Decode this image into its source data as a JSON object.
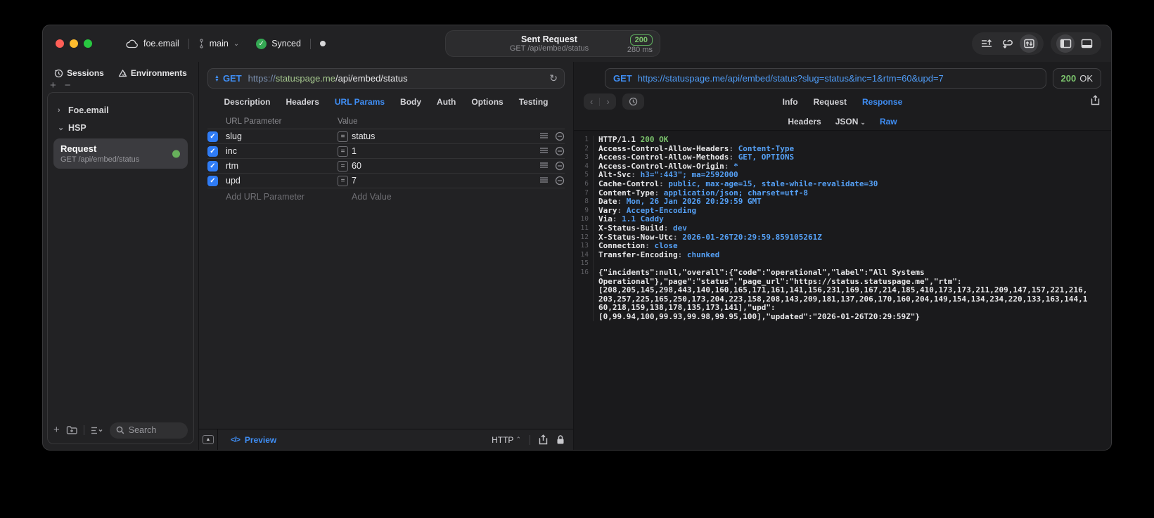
{
  "colors": {
    "accent_blue": "#3f8ef5",
    "status_green": "#7cc56d",
    "checkbox_blue": "#2f7cf6",
    "record_green": "#67b05b"
  },
  "title_bar": {
    "project_name": "foe.email",
    "branch_name": "main",
    "sync_label": "Synced",
    "request_title": "Sent Request",
    "request_subtitle": "GET /api/embed/status",
    "status_code": "200",
    "duration": "280 ms"
  },
  "sidebar": {
    "tabs": [
      {
        "label": "Sessions"
      },
      {
        "label": "Environments"
      }
    ],
    "tree": [
      {
        "label": "Foe.email",
        "state": "collapsed"
      },
      {
        "label": "HSP",
        "state": "expanded"
      }
    ],
    "selected_request": {
      "name": "Request",
      "method_path": "GET /api/embed/status"
    },
    "search_placeholder": "Search"
  },
  "request_editor": {
    "method": "GET",
    "url": {
      "scheme": "https://",
      "host": "statuspage.me",
      "path": "/api/embed/status"
    },
    "tabs": [
      "Description",
      "Headers",
      "URL Params",
      "Body",
      "Auth",
      "Options",
      "Testing"
    ],
    "active_tab": "URL Params",
    "params": {
      "columns": [
        "URL Parameter",
        "Value"
      ],
      "rows": [
        {
          "name": "slug",
          "value": "status",
          "enabled": true
        },
        {
          "name": "inc",
          "value": "1",
          "enabled": true
        },
        {
          "name": "rtm",
          "value": "60",
          "enabled": true
        },
        {
          "name": "upd",
          "value": "7",
          "enabled": true
        }
      ],
      "add_param_label": "Add URL Parameter",
      "add_value_label": "Add Value"
    },
    "footer": {
      "preview_label": "Preview",
      "protocol_label": "HTTP"
    }
  },
  "response_viewer": {
    "method": "GET",
    "url": "https://statuspage.me/api/embed/status?slug=status&inc=1&rtm=60&upd=7",
    "status_code": "200",
    "status_text": "OK",
    "tabs": [
      "Info",
      "Request",
      "Response"
    ],
    "active_tab": "Response",
    "body_tabs": [
      "Headers",
      "JSON",
      "Raw"
    ],
    "active_body_tab": "Raw",
    "code_lines": [
      {
        "n": "1",
        "parts": [
          [
            "w",
            "HTTP/1.1 "
          ],
          [
            "g",
            "200 OK"
          ]
        ]
      },
      {
        "n": "2",
        "parts": [
          [
            "w",
            "Access-Control-Allow-Headers"
          ],
          [
            "d",
            ": "
          ],
          [
            "b",
            "Content-Type"
          ]
        ]
      },
      {
        "n": "3",
        "parts": [
          [
            "w",
            "Access-Control-Allow-Methods"
          ],
          [
            "d",
            ": "
          ],
          [
            "b",
            "GET, OPTIONS"
          ]
        ]
      },
      {
        "n": "4",
        "parts": [
          [
            "w",
            "Access-Control-Allow-Origin"
          ],
          [
            "d",
            ": "
          ],
          [
            "b",
            "*"
          ]
        ]
      },
      {
        "n": "5",
        "parts": [
          [
            "w",
            "Alt-Svc"
          ],
          [
            "d",
            ": "
          ],
          [
            "b",
            "h3=\":443\"; ma=2592000"
          ]
        ]
      },
      {
        "n": "6",
        "parts": [
          [
            "w",
            "Cache-Control"
          ],
          [
            "d",
            ": "
          ],
          [
            "b",
            "public, max-age=15, stale-while-revalidate=30"
          ]
        ]
      },
      {
        "n": "7",
        "parts": [
          [
            "w",
            "Content-Type"
          ],
          [
            "d",
            ": "
          ],
          [
            "b",
            "application/json; charset=utf-8"
          ]
        ]
      },
      {
        "n": "8",
        "parts": [
          [
            "w",
            "Date"
          ],
          [
            "d",
            ": "
          ],
          [
            "b",
            "Mon, 26 Jan 2026 20:29:59 GMT"
          ]
        ]
      },
      {
        "n": "9",
        "parts": [
          [
            "w",
            "Vary"
          ],
          [
            "d",
            ": "
          ],
          [
            "b",
            "Accept-Encoding"
          ]
        ]
      },
      {
        "n": "10",
        "parts": [
          [
            "w",
            "Via"
          ],
          [
            "d",
            ": "
          ],
          [
            "b",
            "1.1 Caddy"
          ]
        ]
      },
      {
        "n": "11",
        "parts": [
          [
            "w",
            "X-Status-Build"
          ],
          [
            "d",
            ": "
          ],
          [
            "b",
            "dev"
          ]
        ]
      },
      {
        "n": "12",
        "parts": [
          [
            "w",
            "X-Status-Now-Utc"
          ],
          [
            "d",
            ": "
          ],
          [
            "b",
            "2026-01-26T20:29:59.859105261Z"
          ]
        ]
      },
      {
        "n": "13",
        "parts": [
          [
            "w",
            "Connection"
          ],
          [
            "d",
            ": "
          ],
          [
            "b",
            "close"
          ]
        ]
      },
      {
        "n": "14",
        "parts": [
          [
            "w",
            "Transfer-Encoding"
          ],
          [
            "d",
            ": "
          ],
          [
            "b",
            "chunked"
          ]
        ]
      },
      {
        "n": "15",
        "parts": []
      },
      {
        "n": "16",
        "parts": [
          [
            "w",
            "{\"incidents\":null,\"overall\":{\"code\":\"operational\",\"label\":\"All Systems"
          ]
        ]
      },
      {
        "n": "",
        "parts": [
          [
            "w",
            "Operational\"},\"page\":\"status\",\"page_url\":\"https://status.statuspage.me\",\"rtm\":"
          ]
        ]
      },
      {
        "n": "",
        "parts": [
          [
            "w",
            "[208,205,145,298,443,140,160,165,171,161,141,156,231,169,167,214,185,410,173,173,211,209,147,157,221,216,"
          ]
        ]
      },
      {
        "n": "",
        "parts": [
          [
            "w",
            "203,257,225,165,250,173,204,223,158,208,143,209,181,137,206,170,160,204,149,154,134,234,220,133,163,144,1"
          ]
        ]
      },
      {
        "n": "",
        "parts": [
          [
            "w",
            "60,218,159,138,178,135,173,141],\"upd\":"
          ]
        ]
      },
      {
        "n": "",
        "parts": [
          [
            "w",
            "[0,99.94,100,99.93,99.98,99.95,100],\"updated\":\"2026-01-26T20:29:59Z\"}"
          ]
        ]
      }
    ]
  }
}
